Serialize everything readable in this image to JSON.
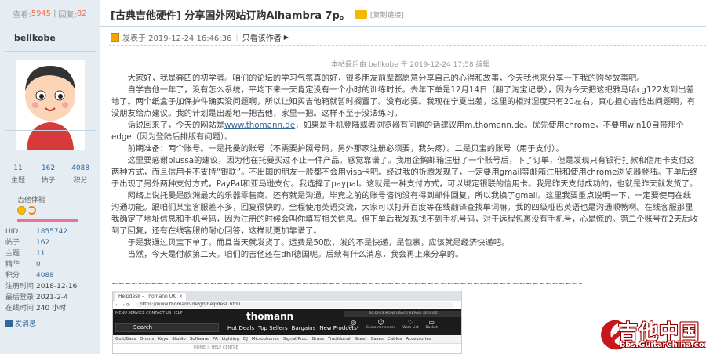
{
  "thread": {
    "views_label": "查看:",
    "views": "5945",
    "replies_label": "回复:",
    "replies": "82",
    "title": "[古典吉他硬件] 分享国外网站订购Alhambra 7p。",
    "copy_link": "[复制链接]"
  },
  "author": {
    "name": "bellkobe",
    "stats": [
      {
        "value": "11",
        "label": "主题"
      },
      {
        "value": "162",
        "label": "帖子"
      },
      {
        "value": "4088",
        "label": "积分"
      }
    ],
    "medal_label": "吉他体验",
    "info": [
      {
        "key": "UID",
        "value": "1855742",
        "link": true
      },
      {
        "key": "帖子",
        "value": "162",
        "link": true
      },
      {
        "key": "主题",
        "value": "11",
        "link": true
      },
      {
        "key": "精华",
        "value": "0",
        "link": true
      },
      {
        "key": "积分",
        "value": "4088",
        "link": true
      },
      {
        "key": "注册时间",
        "value": "2018-12-16",
        "link": false
      },
      {
        "key": "最后登录",
        "value": "2021-2-4",
        "link": false
      },
      {
        "key": "在线时间",
        "value": "240 小时",
        "link": false
      }
    ],
    "send_message": "发消息"
  },
  "post": {
    "posted": "发表于 2019-12-24 16:46:36",
    "only_author": "只看该作者",
    "edited": "本帖最后由 bellkobe 于 2019-12-24 17:58 编辑",
    "p1": "大家好，我是奔四的初学者。咱们的论坛的学习气氛真的好，很多朋友前辈都愿意分享自己的心得和故事，今天我也来分享一下我的购琴故事吧。",
    "p2": "自学吉他一年了，没有怎么系统，平均下来一天肯定没有一个小时的训练时长。去年下单是12月14日（翻了淘宝记录），因为今天把这把雅马哈cg122发到出差地了。两个纸盒子加保护件确实没问题啊，所以让知买吉他箱就暂时搁置了。没有必要。我现在宁夏出差，这里的相对湿度只有20左右，真心担心吉他出问题啊，有没朋友给点建议。我的计划是出差地一把吉他，家里一把。这样不至于没法练习。",
    "p3_a": "话说回来了，今天的网站是",
    "p3_link": "www.thomann.de",
    "p3_b": "，如果是手机登陆或者浏览器有问题的话建议用m.thomann.de。优先使用chrome，不要用win10自带那个edge（因为登陆后排版有问题）。",
    "p4": "前期准备：两个账号。一是托曼的账号（不需要护照号码，另外那家注册必须要，我头疼）。二是贝宝的账号（用于支付）。",
    "p5": "这里要感谢plussa的建议，因为他在托曼买过不止一件产品。感觉靠谱了。我用企鹅邮箱注册了一个账号后，下了订单，但是发现只有银行打款和信用卡支付这两种方式，而且信用卡不支持“银联”。不出国的朋友一般都不会用visa卡吧。经过我的折腾发现了，一定要用gmail等邮箱注册和使用chrome浏览器登陆。下单后终于出现了另外两种支付方式，PayPal和亚马逊支付。我选择了paypal。这就是一种支付方式，可以绑定银联的信用卡。我是昨天支付成功的，也就是昨天就发货了。",
    "p6": "网络上说托曼是欧洲最大的乐器零售商。还有就是沟通，毕竟之前的账号咨询没有得到邮件回复，所以我换了gmail。这里我要重点说明一下，一定要使用在线沟通功能。跟咱们某宝客服差不多，回复很快的。全程使用英语交流，大家可以打开百度等在线翻译查找单词嘛。我的四级哑巴英语也是沟通顺畅啊。在线客服那里我确定了地址信息和手机号码，因为注册的时候会叫你填写相关信息。但下单后我发现找不到手机号码，对于远程包裹没有手机号，心是慌的。第二个账号在2天后收到了回复，还有在线客服的耐心回答，这样就更加靠谱了。",
    "p7": "于是我通过贝宝下单了。而且当天就发货了。运费是50欧，发的不是快递，是包裹，应该就是经济快递吧。",
    "p8": "当然，今天是付款第二天。咱们的吉他还在dhl德国呢。后续有什么消息，我会再上来分享的。",
    "tildes": "~~~~~~~~~~~~~~~~~~~~~~~~~~~~~~~~~~~~~~~~~~~~~~~~~~~~~~~~~~~~~~~~~~~~~~~~~~~~~~~~~~~~~~~~~~~~~~~~~~~~~~~~~~~~"
  },
  "screenshot": {
    "tab_title": "Helpdesk – Thomann UK",
    "url": "https://www.thomann.de/gb/helpdesk.html",
    "menu": "MENU  SERVICE  CONTACT US  HELP",
    "logo": "thomann",
    "strip": "30-DAYS MONEY-BACK  REPAIR SERVICE",
    "search": "Search",
    "nav": [
      "Hot Deals",
      "Top Sellers",
      "Bargains",
      "New Products"
    ],
    "icons": [
      {
        "glyph": "◎",
        "label": "GB · £"
      },
      {
        "glyph": "☺",
        "label": "Customer centre"
      },
      {
        "glyph": "♡",
        "label": "Wish List"
      },
      {
        "glyph": "▭",
        "label": "Basket"
      }
    ],
    "categories": [
      "Guit/Bass",
      "Drums",
      "Keys",
      "Studio",
      "Software",
      "PA",
      "Lighting",
      "DJ",
      "Microphones",
      "Signal Proc.",
      "Brass",
      "Traditional",
      "Sheet",
      "Cases",
      "Cables",
      "Accessories"
    ],
    "crumb": "HOME > HELP CENTRE"
  },
  "watermark": {
    "text": "吉他中国",
    "url": "bbs.GuitarChina.com"
  },
  "colors": {
    "sidebar_bg": "#e5edf2",
    "border": "#c2d5e3",
    "link": "#336699",
    "accent_red": "#f26c4f"
  }
}
